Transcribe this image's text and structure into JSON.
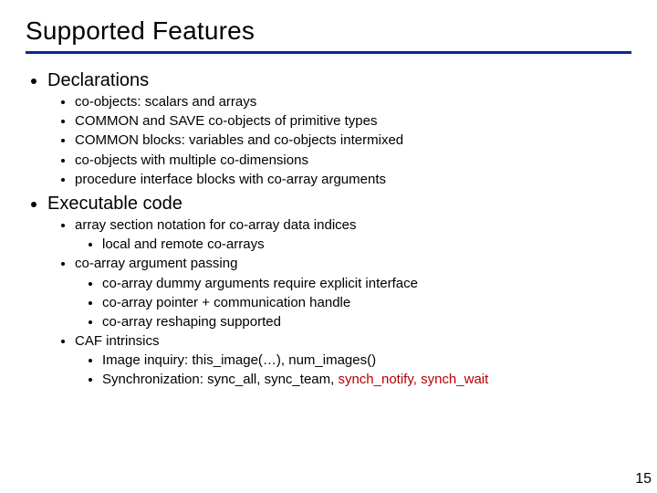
{
  "title": "Supported Features",
  "sections": [
    {
      "heading": "Declarations",
      "items": [
        {
          "text": "co-objects: scalars and arrays"
        },
        {
          "text": "COMMON and SAVE co-objects of primitive types"
        },
        {
          "text": "COMMON blocks: variables and co-objects intermixed"
        },
        {
          "text": "co-objects with multiple co-dimensions"
        },
        {
          "text": "procedure interface blocks with co-array arguments"
        }
      ]
    },
    {
      "heading": "Executable code",
      "items": [
        {
          "text": "array section notation for co-array data indices",
          "children": [
            {
              "text": "local and remote co-arrays"
            }
          ]
        },
        {
          "text": "co-array argument passing",
          "children": [
            {
              "text": "co-array dummy arguments require explicit interface"
            },
            {
              "text": "co-array pointer + communication handle"
            },
            {
              "text": "co-array reshaping supported"
            }
          ]
        },
        {
          "text": "CAF intrinsics",
          "children": [
            {
              "text": "Image inquiry: this_image(…), num_images()"
            },
            {
              "text_prefix": "Synchronization: sync_all, sync_team, ",
              "red_parts": [
                "synch_notify",
                ", ",
                "synch_wait"
              ]
            }
          ]
        }
      ]
    }
  ],
  "page_number": "15"
}
